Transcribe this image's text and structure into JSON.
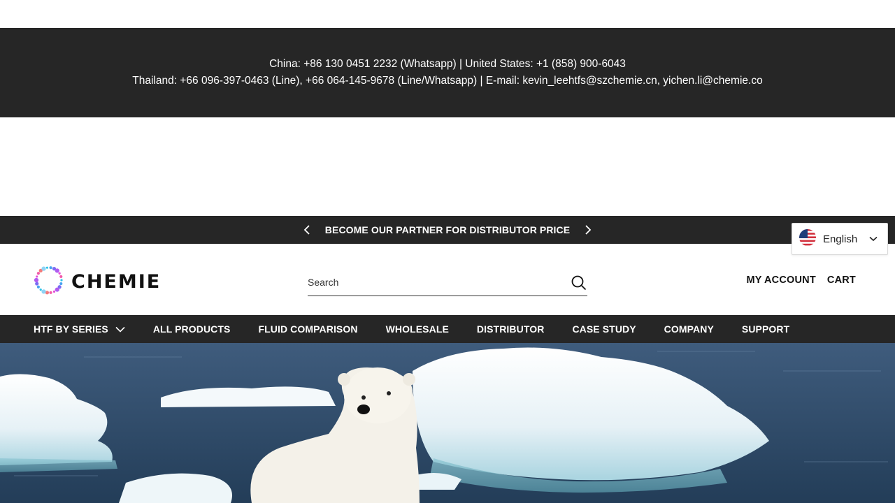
{
  "contact": {
    "line1": "China: +86 130 0451 2232 (Whatsapp) | United States: +1 (858) 900-6043",
    "line2": "Thailand: +66 096-397-0463 (Line), +66 064-145-9678 (Line/Whatsapp) | E-mail: kevin_leehtfs@szchemie.cn, yichen.li@chemie.co"
  },
  "promo": {
    "text": "BECOME OUR PARTNER FOR DISTRIBUTOR PRICE"
  },
  "language": {
    "selected": "English",
    "flag_icon": "us-flag-icon"
  },
  "header": {
    "logo_text": "CHEMIE",
    "search_placeholder": "Search",
    "my_account": "MY ACCOUNT",
    "cart": "CART"
  },
  "nav": {
    "items": [
      {
        "label": "HTF BY SERIES",
        "has_dropdown": true
      },
      {
        "label": "ALL PRODUCTS"
      },
      {
        "label": "FLUID COMPARISON"
      },
      {
        "label": "WHOLESALE"
      },
      {
        "label": "DISTRIBUTOR"
      },
      {
        "label": "CASE STUDY"
      },
      {
        "label": "COMPANY"
      },
      {
        "label": "SUPPORT"
      }
    ]
  },
  "colors": {
    "dark_bar": "#262626",
    "white": "#ffffff"
  }
}
